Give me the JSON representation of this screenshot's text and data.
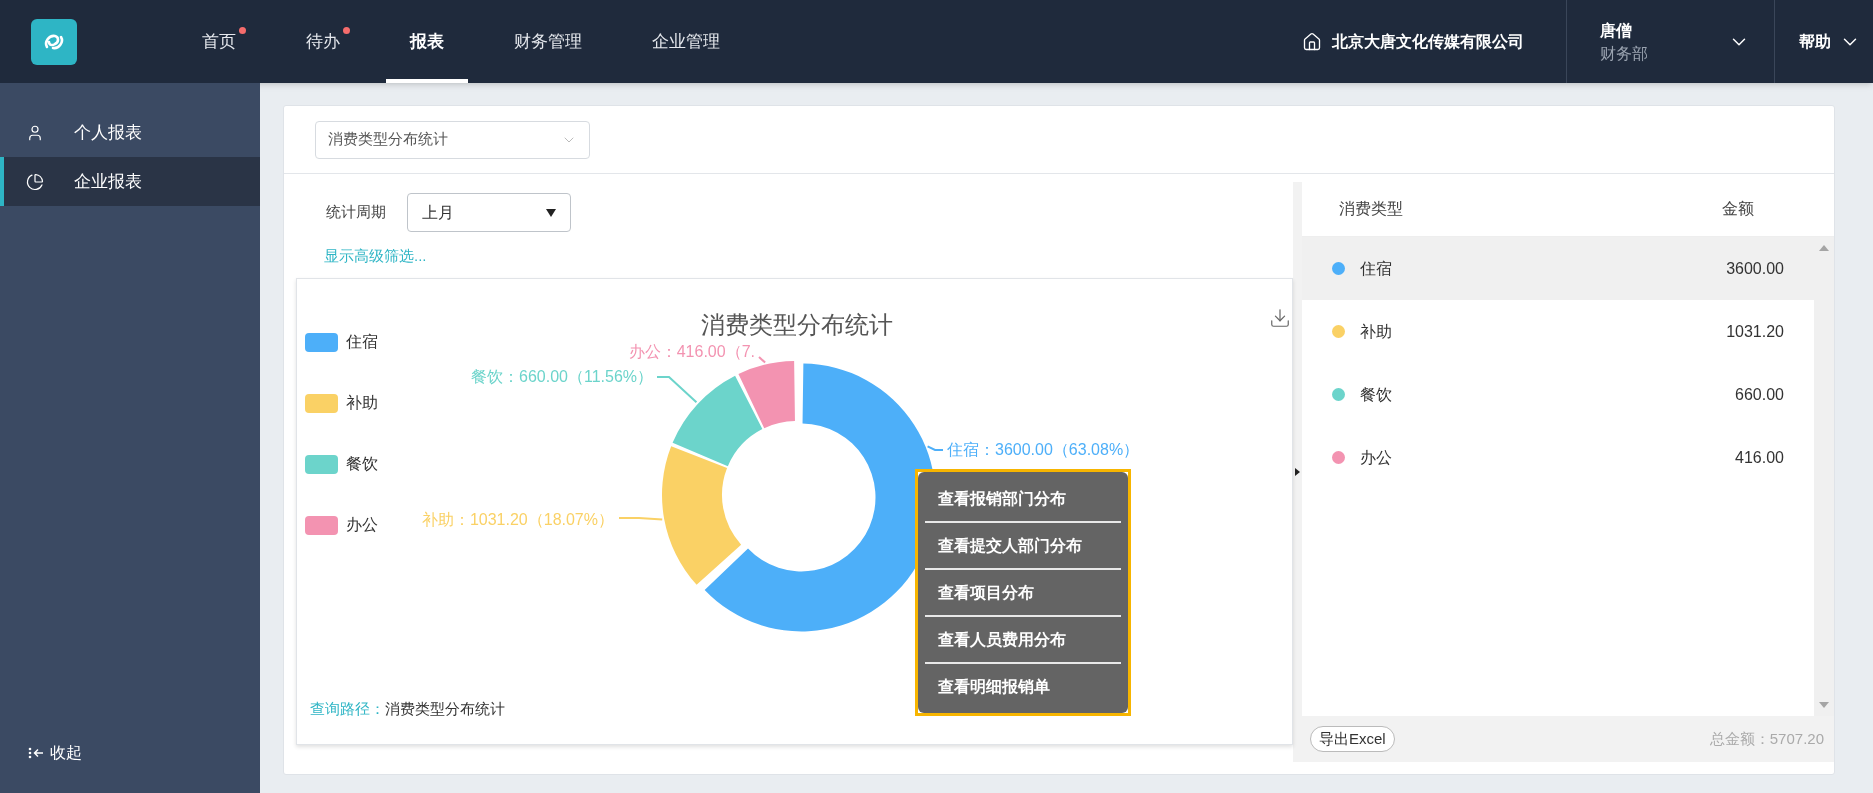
{
  "nav": [
    {
      "label": "首页",
      "selected": false,
      "unread": true
    },
    {
      "label": "待办",
      "selected": false,
      "unread": true
    },
    {
      "label": "报表",
      "selected": true,
      "unread": false
    },
    {
      "label": "财务管理",
      "selected": false,
      "unread": false
    },
    {
      "label": "企业管理",
      "selected": false,
      "unread": false
    }
  ],
  "company": "北京大唐文化传媒有限公司",
  "user": {
    "name": "唐僧",
    "department": "财务部"
  },
  "help": "帮助",
  "sidebar": {
    "items": [
      {
        "label": "个人报表",
        "kind": "person",
        "selected": false
      },
      {
        "label": "企业报表",
        "kind": "pie",
        "selected": true
      }
    ],
    "collapse": "收起"
  },
  "report_select": {
    "value": "消费类型分布统计"
  },
  "filters": {
    "period_label": "统计周期",
    "period_value": "上月",
    "advanced_link": "显示高级筛选..."
  },
  "chart": {
    "legend": [
      {
        "color": "#4daff9"
      },
      {
        "color": "#fad165"
      },
      {
        "color": "#6cd4cb"
      },
      {
        "color": "#f393b1"
      }
    ],
    "chart_data": {
      "type": "donut",
      "title": "消费类型分布统计",
      "categories": [
        "住宿",
        "补助",
        "餐饮",
        "办公"
      ],
      "values": [
        3600,
        1031.2,
        660,
        416
      ],
      "value_labels": [
        "住宿：3600.00（63.08%）",
        "补助：1031.20（18.07%）",
        "餐饮：660.00（11.56%）",
        "办公：416.00（7."
      ]
    },
    "context_menu": [
      {
        "label": "查看报销部门分布"
      },
      {
        "label": "查看提交人部门分布"
      },
      {
        "label": "查看项目分布"
      },
      {
        "label": "查看人员费用分布"
      },
      {
        "label": "查看明细报销单"
      }
    ],
    "query_path": {
      "label": "查询路径：",
      "value": "消费类型分布统计"
    }
  },
  "table": {
    "columns": [
      "消费类型",
      "金额"
    ],
    "rows": [
      {
        "name": "住宿",
        "amount": "3600.00",
        "color": "#4daff9",
        "selected": true
      },
      {
        "name": "补助",
        "amount": "1031.20",
        "color": "#fad165",
        "selected": false
      },
      {
        "name": "餐饮",
        "amount": "660.00",
        "color": "#6cd4cb",
        "selected": false
      },
      {
        "name": "办公",
        "amount": "416.00",
        "color": "#f393b1",
        "selected": false
      }
    ],
    "export_button": "导出Excel",
    "total": "总金额：5707.20"
  }
}
